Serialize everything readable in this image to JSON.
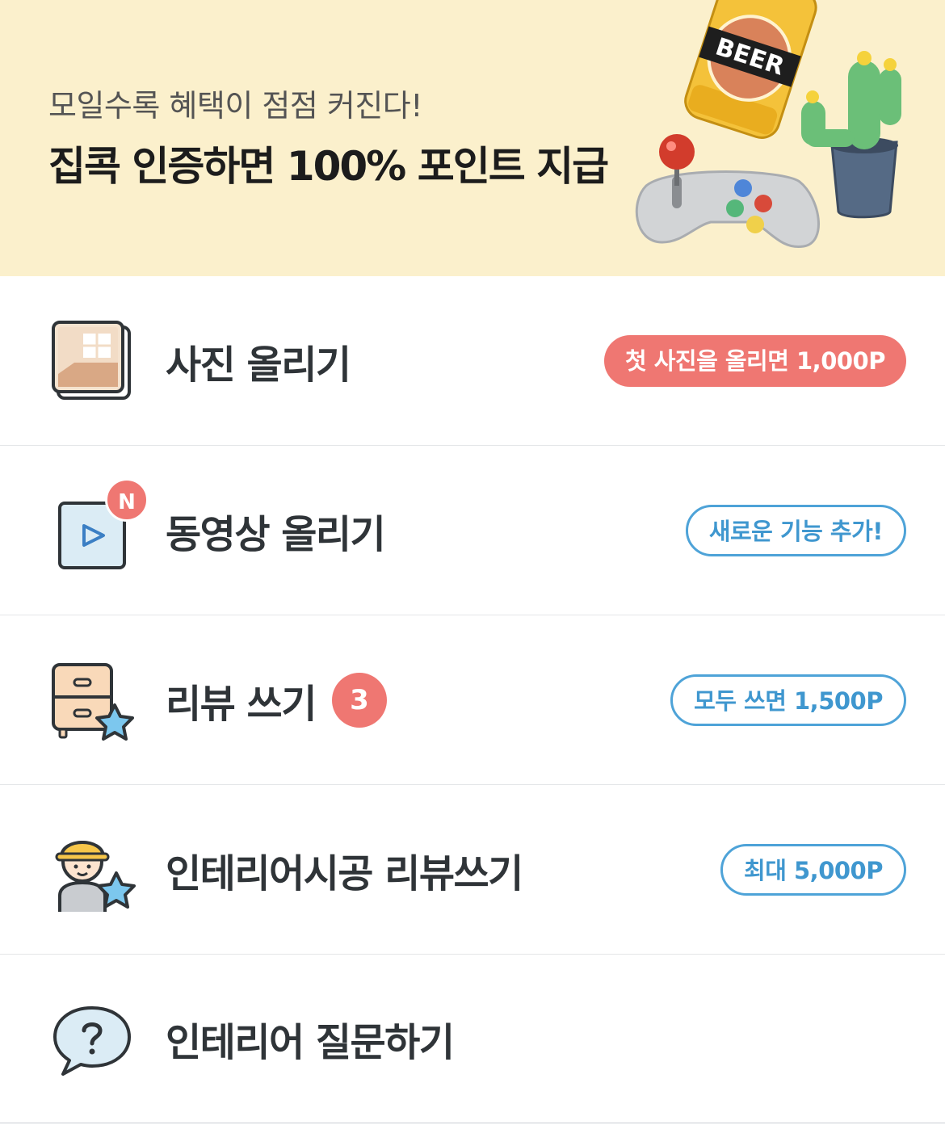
{
  "banner": {
    "subtitle": "모일수록 혜택이 점점 커진다!",
    "title": "집콕 인증하면 100% 포인트 지급",
    "can_label": "BEER",
    "background_color": "#fbf0cc",
    "illustrations": [
      "beer-can-icon",
      "game-controller-icon",
      "cactus-icon"
    ]
  },
  "menu": {
    "items": [
      {
        "label": "사진 올리기",
        "icon": "photo-icon",
        "pill": "첫 사진을 올리면 1,000P",
        "pill_style": "filled"
      },
      {
        "label": "동영상 올리기",
        "icon": "video-play-icon",
        "new_badge": "N",
        "pill": "새로운 기능 추가!",
        "pill_style": "outline"
      },
      {
        "label": "리뷰 쓰기",
        "icon": "cabinet-star-icon",
        "count": "3",
        "pill": "모두 쓰면 1,500P",
        "pill_style": "outline"
      },
      {
        "label": "인테리어시공 리뷰쓰기",
        "icon": "worker-star-icon",
        "pill": "최대 5,000P",
        "pill_style": "outline"
      },
      {
        "label": "인테리어 질문하기",
        "icon": "question-bubble-icon"
      }
    ]
  },
  "colors": {
    "accent_red": "#ef7772",
    "accent_blue": "#4ea3d8",
    "text_dark": "#2f3438"
  }
}
